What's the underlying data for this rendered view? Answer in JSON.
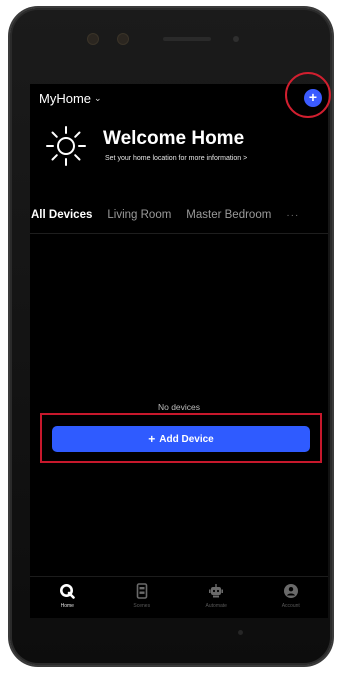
{
  "header": {
    "home_name": "MyHome"
  },
  "welcome": {
    "title": "Welcome Home",
    "subtitle": "Set your home location for more information >"
  },
  "tabs": [
    {
      "label": "All Devices",
      "active": true
    },
    {
      "label": "Living Room",
      "active": false
    },
    {
      "label": "Master Bedroom",
      "active": false
    }
  ],
  "tabs_more": "···",
  "empty_state": {
    "label": "No devices",
    "button_label": "Add Device"
  },
  "bottom_nav": [
    {
      "label": "Home",
      "icon": "home-q-icon",
      "active": true
    },
    {
      "label": "Scenes",
      "icon": "scenes-icon",
      "active": false
    },
    {
      "label": "Automate",
      "icon": "automate-robot-icon",
      "active": false
    },
    {
      "label": "Account",
      "icon": "account-icon",
      "active": false
    }
  ],
  "colors": {
    "accent": "#2f5bff",
    "background": "#000000",
    "highlight": "#d11f2f"
  }
}
